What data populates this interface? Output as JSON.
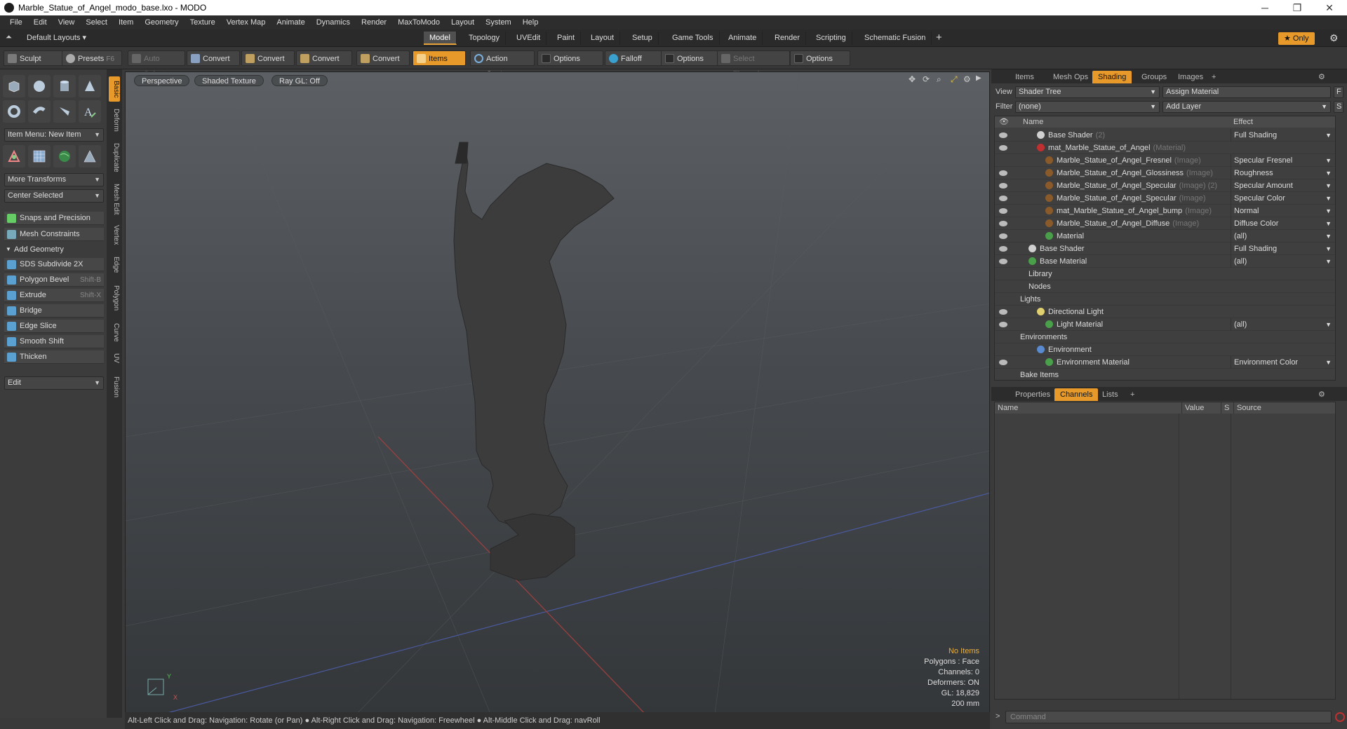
{
  "window": {
    "title": "Marble_Statue_of_Angel_modo_base.lxo - MODO",
    "controls": [
      "─",
      "❐",
      "✕"
    ]
  },
  "menu": [
    "File",
    "Edit",
    "View",
    "Select",
    "Item",
    "Geometry",
    "Texture",
    "Vertex Map",
    "Animate",
    "Dynamics",
    "Render",
    "MaxToModo",
    "Layout",
    "System",
    "Help"
  ],
  "layoutbar": {
    "layout_select": "Default Layouts",
    "tabs": [
      "Model",
      "Topology",
      "UVEdit",
      "Paint",
      "Layout",
      "Setup",
      "Game Tools",
      "Animate",
      "Render",
      "Scripting",
      "Schematic Fusion"
    ],
    "active_tab": "Model",
    "add": "+",
    "only": "Only"
  },
  "toolbar": {
    "sculpt": "Sculpt",
    "presets": "Presets",
    "presets_key": "F6",
    "auto_select": "Auto Select",
    "convert1": "Convert",
    "convert2": "Convert",
    "convert3": "Convert",
    "convert4": "Convert",
    "items": "Items",
    "action_center": "Action Center",
    "options1": "Options",
    "falloff": "Falloff",
    "options2": "Options",
    "select_through": "Select Through",
    "options3": "Options"
  },
  "leftpanel": {
    "item_menu": "Item Menu: New Item",
    "more_transforms": "More Transforms",
    "center_selected": "Center Selected",
    "snaps": "Snaps and Precision",
    "mesh_constraints": "Mesh Constraints",
    "add_geometry": "Add Geometry",
    "tools": [
      {
        "label": "SDS Subdivide 2X",
        "key": ""
      },
      {
        "label": "Polygon Bevel",
        "key": "Shift-B"
      },
      {
        "label": "Extrude",
        "key": "Shift-X"
      },
      {
        "label": "Bridge",
        "key": ""
      },
      {
        "label": "Edge Slice",
        "key": ""
      },
      {
        "label": "Smooth Shift",
        "key": ""
      },
      {
        "label": "Thicken",
        "key": ""
      }
    ],
    "edit": "Edit",
    "side_tabs": [
      "Basic",
      "Deform",
      "Duplicate",
      "Mesh Edit",
      "Vertex",
      "Edge",
      "Polygon",
      "Curve",
      "UV",
      "Fusion"
    ]
  },
  "viewport": {
    "view": "Perspective",
    "shading": "Shaded Texture",
    "raygl": "Ray GL: Off",
    "stats": {
      "items": "No Items",
      "polygons": "Polygons : Face",
      "channels": "Channels: 0",
      "deformers": "Deformers: ON",
      "gl": "GL: 18,829",
      "size": "200 mm"
    }
  },
  "status": "Alt-Left Click and Drag: Navigation: Rotate (or Pan) ● Alt-Right Click and Drag: Navigation: Freewheel ● Alt-Middle Click and Drag: navRoll",
  "rightpanel": {
    "tabs": [
      "Items",
      "Mesh Ops",
      "Shading",
      "Groups",
      "Images"
    ],
    "active_tab": "Shading",
    "view_label": "View",
    "view_value": "Shader Tree",
    "assign_material": "Assign Material",
    "filter_label": "Filter",
    "filter_value": "(none)",
    "add_layer": "Add Layer",
    "f_btn": "F",
    "s_btn": "S",
    "col_name": "Name",
    "col_effect": "Effect",
    "rows": [
      {
        "name": "Base Shader",
        "sub": "(2)",
        "effect": "Full Shading",
        "indent": 60,
        "ball": "#d0d0d0",
        "eye": true
      },
      {
        "name": "mat_Marble_Statue_of_Angel",
        "sub": "(Material)",
        "effect": "",
        "indent": 60,
        "ball": "#c03030",
        "eye": true
      },
      {
        "name": "Marble_Statue_of_Angel_Fresnel",
        "sub": "(Image)",
        "effect": "Specular Fresnel",
        "indent": 72,
        "ball": "#8a5a2a",
        "eye": false
      },
      {
        "name": "Marble_Statue_of_Angel_Glossiness",
        "sub": "(Image)",
        "effect": "Roughness",
        "indent": 72,
        "ball": "#8a5a2a",
        "eye": true
      },
      {
        "name": "Marble_Statue_of_Angel_Specular",
        "sub": "(Image) (2)",
        "effect": "Specular Amount",
        "indent": 72,
        "ball": "#8a5a2a",
        "eye": true
      },
      {
        "name": "Marble_Statue_of_Angel_Specular",
        "sub": "(Image)",
        "effect": "Specular Color",
        "indent": 72,
        "ball": "#8a5a2a",
        "eye": true
      },
      {
        "name": "mat_Marble_Statue_of_Angel_bump",
        "sub": "(Image)",
        "effect": "Normal",
        "indent": 72,
        "ball": "#8a5a2a",
        "eye": true
      },
      {
        "name": "Marble_Statue_of_Angel_Diffuse",
        "sub": "(Image)",
        "effect": "Diffuse Color",
        "indent": 72,
        "ball": "#8a5a2a",
        "eye": true
      },
      {
        "name": "Material",
        "sub": "",
        "effect": "(all)",
        "indent": 72,
        "ball": "#4aa04a",
        "eye": true
      },
      {
        "name": "Base Shader",
        "sub": "",
        "effect": "Full Shading",
        "indent": 48,
        "ball": "#d0d0d0",
        "eye": true
      },
      {
        "name": "Base Material",
        "sub": "",
        "effect": "(all)",
        "indent": 48,
        "ball": "#4aa04a",
        "eye": true
      },
      {
        "name": "Library",
        "sub": "",
        "effect": "",
        "indent": 48,
        "ball": "",
        "eye": false
      },
      {
        "name": "Nodes",
        "sub": "",
        "effect": "",
        "indent": 48,
        "ball": "",
        "eye": false
      },
      {
        "name": "Lights",
        "sub": "",
        "effect": "",
        "indent": 36,
        "ball": "",
        "eye": false
      },
      {
        "name": "Directional Light",
        "sub": "",
        "effect": "",
        "indent": 60,
        "ball": "#e0d070",
        "eye": true
      },
      {
        "name": "Light Material",
        "sub": "",
        "effect": "(all)",
        "indent": 72,
        "ball": "#4aa04a",
        "eye": true
      },
      {
        "name": "Environments",
        "sub": "",
        "effect": "",
        "indent": 36,
        "ball": "",
        "eye": false
      },
      {
        "name": "Environment",
        "sub": "",
        "effect": "",
        "indent": 60,
        "ball": "#5a8ad0",
        "eye": false
      },
      {
        "name": "Environment Material",
        "sub": "",
        "effect": "Environment Color",
        "indent": 72,
        "ball": "#4aa04a",
        "eye": true
      },
      {
        "name": "Bake Items",
        "sub": "",
        "effect": "",
        "indent": 36,
        "ball": "",
        "eye": false
      }
    ],
    "lower_tabs": [
      "Properties",
      "Channels",
      "Lists"
    ],
    "lower_active": "Channels",
    "channel_cols": [
      "Name",
      "Value",
      "S",
      "Source"
    ],
    "command_placeholder": "Command"
  }
}
